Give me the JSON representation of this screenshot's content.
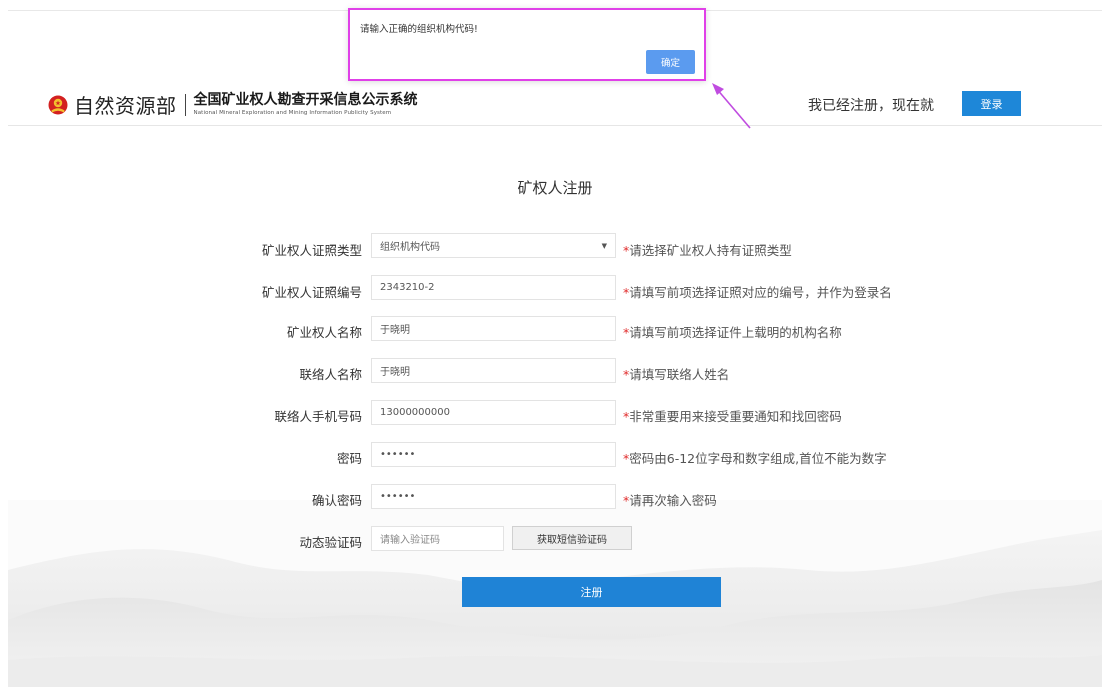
{
  "dialog": {
    "message": "请输入正确的组织机构代码!",
    "confirm_label": "确定"
  },
  "header": {
    "ministry_name": "自然资源部",
    "system_name": "全国矿业权人勘查开采信息公示系统",
    "system_name_en": "National Mineral Exploration and Mining Information Publicity System",
    "registered_text": "我已经注册，现在就",
    "login_label": "登录",
    "brand_color": "#1e87d8"
  },
  "form": {
    "title": "矿权人注册",
    "fields": [
      {
        "label": "矿业权人证照类型",
        "value": "组织机构代码",
        "hint": "请选择矿业权人持有证照类型"
      },
      {
        "label": "矿业权人证照编号",
        "value": "2343210-2",
        "hint": "请填写前项选择证照对应的编号，并作为登录名"
      },
      {
        "label": "矿业权人名称",
        "value": "于晓明",
        "hint": "请填写前项选择证件上载明的机构名称"
      },
      {
        "label": "联络人名称",
        "value": "于晓明",
        "hint": "请填写联络人姓名"
      },
      {
        "label": "联络人手机号码",
        "value": "13000000000",
        "hint": "非常重要用来接受重要通知和找回密码"
      },
      {
        "label": "密码",
        "value": "••••••",
        "hint": "密码由6-12位字母和数字组成,首位不能为数字"
      },
      {
        "label": "确认密码",
        "value": "••••••",
        "hint": "请再次输入密码"
      }
    ],
    "captcha": {
      "label": "动态验证码",
      "placeholder": "请输入验证码",
      "sms_button_label": "获取短信验证码"
    },
    "required_mark": "*",
    "submit_label": "注册"
  }
}
